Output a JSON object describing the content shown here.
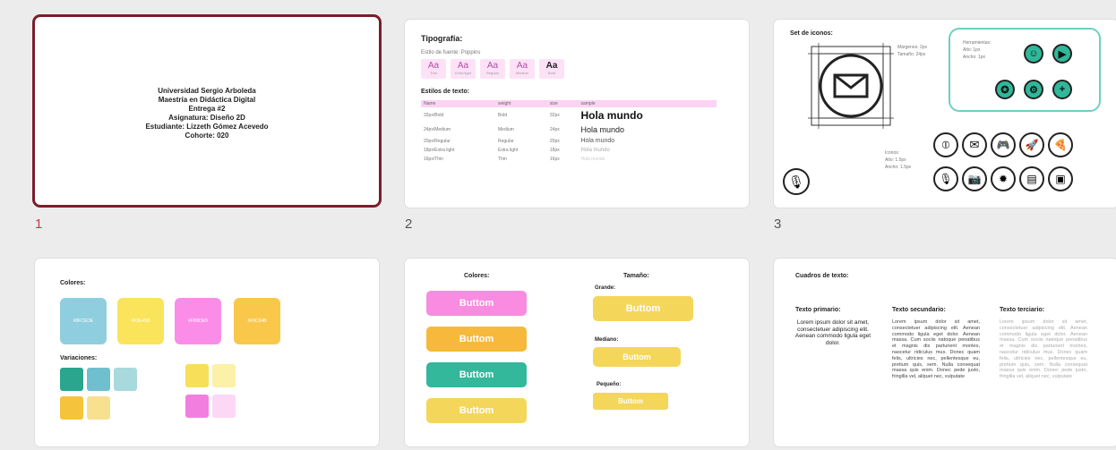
{
  "slides": [
    {
      "number": "1",
      "lines": [
        "Universidad Sergio Arboleda",
        "Maestría en Didáctica Digital",
        "Entrega #2",
        "Asignatura: Diseño 2D",
        "Estudiante: Lizzeth Gómez Acevedo",
        "Cohorte: 020"
      ]
    },
    {
      "number": "2",
      "heading": "Tipografía:",
      "font_label": "Estilo de fuente: Poppins",
      "weights": [
        {
          "glyph": "Aa",
          "name": "Thin"
        },
        {
          "glyph": "Aa",
          "name": "Extra light"
        },
        {
          "glyph": "Aa",
          "name": "Regular"
        },
        {
          "glyph": "Aa",
          "name": "Medium"
        },
        {
          "glyph": "Aa",
          "name": "Bold"
        }
      ],
      "styles_heading": "Estilos de texto:",
      "table_headers": [
        "Name",
        "weight",
        "size",
        "sample"
      ],
      "rows": [
        [
          "32px/Bold",
          "Bold",
          "32px",
          "Hola mundo"
        ],
        [
          "24px/Medium",
          "Medium",
          "24px",
          "Hola mundo"
        ],
        [
          "20px/Regular",
          "Regular",
          "20px",
          "Hola mundo"
        ],
        [
          "18px/Extra light",
          "Extra light",
          "18px",
          "Hola mundo"
        ],
        [
          "16px/Thin",
          "Thin",
          "16px",
          "Hola mundo"
        ]
      ]
    },
    {
      "number": "3",
      "heading": "Set de iconos:",
      "margins": "Márgenes: 2px",
      "size": "Tamaño: 24px",
      "tools": "Herramientas:",
      "tools_alto": "Alto: 1px",
      "tools_ancho": "Ancho: 1px",
      "icons_label": "Iconos:",
      "icons_alto": "Alto: 1.5px",
      "icons_ancho": "Ancho: 1.5px"
    },
    {
      "number": "",
      "heading": "Colores:",
      "variations": "Variaciones:",
      "colors": [
        "#8FCEDE",
        "#F9E45B",
        "#FB8DE9",
        "#F9C84B"
      ],
      "color_hex": [
        "#8FCEDE",
        "#F9E45B",
        "#FB8DE9",
        "#F9C84B"
      ]
    },
    {
      "number": "",
      "colors_heading": "Colores:",
      "size_heading": "Tamaño:",
      "grande": "Grande:",
      "mediano": "Mediano:",
      "pequeno": "Pequeño:",
      "button_label": "Buttom",
      "button_colors": [
        "#F98BE0",
        "#F6B93B",
        "#33B89B",
        "#F4D65A"
      ],
      "size_button_color": "#F4D65A"
    },
    {
      "number": "",
      "heading": "Cuadros de texto:",
      "primary": "Texto primario:",
      "secondary": "Texto secundario:",
      "tertiary": "Texto terciario:",
      "primary_text": "Lorem ipsum dolor sit amet, consectetuer adipiscing elit. Aenean commodo ligula eget dolor.",
      "long_text": "Lorem ipsum dolor sit amet, consectetuer adipiscing elit. Aenean commodo ligula eget dolor. Aenean massa. Cum sociis natoque penatibus et magnis dis parturient montes, nascetur ridiculus mus. Donec quam felis, ultricies nec, pellentesque eu, pretium quis, sem. Nulla consequat massa quis enim. Donec pede justo, fringilla vel, aliquet nec, vulputate"
    }
  ]
}
